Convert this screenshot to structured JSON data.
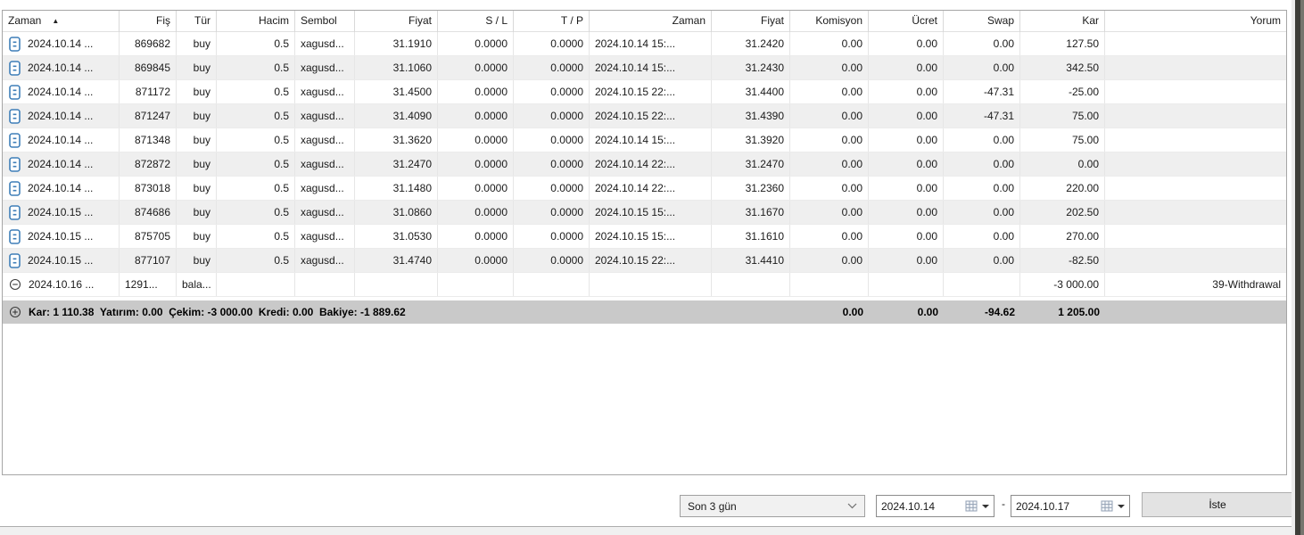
{
  "table": {
    "sort": {
      "column": "Zaman",
      "direction": "asc",
      "indicator": "▲"
    },
    "columns": [
      {
        "id": "time",
        "label": "Zaman"
      },
      {
        "id": "deal",
        "label": "Fiş"
      },
      {
        "id": "type",
        "label": "Tür"
      },
      {
        "id": "volume",
        "label": "Hacim"
      },
      {
        "id": "symbol",
        "label": "Sembol"
      },
      {
        "id": "price",
        "label": "Fiyat"
      },
      {
        "id": "sl",
        "label": "S / L"
      },
      {
        "id": "tp",
        "label": "T / P"
      },
      {
        "id": "close_time",
        "label": "Zaman"
      },
      {
        "id": "close_price",
        "label": "Fiyat"
      },
      {
        "id": "commission",
        "label": "Komisyon"
      },
      {
        "id": "fee",
        "label": "Ücret"
      },
      {
        "id": "swap",
        "label": "Swap"
      },
      {
        "id": "profit",
        "label": "Kar"
      },
      {
        "id": "comment",
        "label": "Yorum"
      }
    ],
    "rows": [
      {
        "icon": "receipt-icon",
        "time": "2024.10.14 ...",
        "deal": "869682",
        "type": "buy",
        "volume": "0.5",
        "symbol": "xagusd...",
        "price": "31.1910",
        "sl": "0.0000",
        "tp": "0.0000",
        "close_time": "2024.10.14 15:...",
        "close_price": "31.2420",
        "commission": "0.00",
        "fee": "0.00",
        "swap": "0.00",
        "profit": "127.50",
        "comment": ""
      },
      {
        "icon": "receipt-icon",
        "time": "2024.10.14 ...",
        "deal": "869845",
        "type": "buy",
        "volume": "0.5",
        "symbol": "xagusd...",
        "price": "31.1060",
        "sl": "0.0000",
        "tp": "0.0000",
        "close_time": "2024.10.14 15:...",
        "close_price": "31.2430",
        "commission": "0.00",
        "fee": "0.00",
        "swap": "0.00",
        "profit": "342.50",
        "comment": ""
      },
      {
        "icon": "receipt-icon",
        "time": "2024.10.14 ...",
        "deal": "871172",
        "type": "buy",
        "volume": "0.5",
        "symbol": "xagusd...",
        "price": "31.4500",
        "sl": "0.0000",
        "tp": "0.0000",
        "close_time": "2024.10.15 22:...",
        "close_price": "31.4400",
        "commission": "0.00",
        "fee": "0.00",
        "swap": "-47.31",
        "profit": "-25.00",
        "comment": ""
      },
      {
        "icon": "receipt-icon",
        "time": "2024.10.14 ...",
        "deal": "871247",
        "type": "buy",
        "volume": "0.5",
        "symbol": "xagusd...",
        "price": "31.4090",
        "sl": "0.0000",
        "tp": "0.0000",
        "close_time": "2024.10.15 22:...",
        "close_price": "31.4390",
        "commission": "0.00",
        "fee": "0.00",
        "swap": "-47.31",
        "profit": "75.00",
        "comment": ""
      },
      {
        "icon": "receipt-icon",
        "time": "2024.10.14 ...",
        "deal": "871348",
        "type": "buy",
        "volume": "0.5",
        "symbol": "xagusd...",
        "price": "31.3620",
        "sl": "0.0000",
        "tp": "0.0000",
        "close_time": "2024.10.14 15:...",
        "close_price": "31.3920",
        "commission": "0.00",
        "fee": "0.00",
        "swap": "0.00",
        "profit": "75.00",
        "comment": ""
      },
      {
        "icon": "receipt-icon",
        "time": "2024.10.14 ...",
        "deal": "872872",
        "type": "buy",
        "volume": "0.5",
        "symbol": "xagusd...",
        "price": "31.2470",
        "sl": "0.0000",
        "tp": "0.0000",
        "close_time": "2024.10.14 22:...",
        "close_price": "31.2470",
        "commission": "0.00",
        "fee": "0.00",
        "swap": "0.00",
        "profit": "0.00",
        "comment": ""
      },
      {
        "icon": "receipt-icon",
        "time": "2024.10.14 ...",
        "deal": "873018",
        "type": "buy",
        "volume": "0.5",
        "symbol": "xagusd...",
        "price": "31.1480",
        "sl": "0.0000",
        "tp": "0.0000",
        "close_time": "2024.10.14 22:...",
        "close_price": "31.2360",
        "commission": "0.00",
        "fee": "0.00",
        "swap": "0.00",
        "profit": "220.00",
        "comment": ""
      },
      {
        "icon": "receipt-icon",
        "time": "2024.10.15 ...",
        "deal": "874686",
        "type": "buy",
        "volume": "0.5",
        "symbol": "xagusd...",
        "price": "31.0860",
        "sl": "0.0000",
        "tp": "0.0000",
        "close_time": "2024.10.15 15:...",
        "close_price": "31.1670",
        "commission": "0.00",
        "fee": "0.00",
        "swap": "0.00",
        "profit": "202.50",
        "comment": ""
      },
      {
        "icon": "receipt-icon",
        "time": "2024.10.15 ...",
        "deal": "875705",
        "type": "buy",
        "volume": "0.5",
        "symbol": "xagusd...",
        "price": "31.0530",
        "sl": "0.0000",
        "tp": "0.0000",
        "close_time": "2024.10.15 15:...",
        "close_price": "31.1610",
        "commission": "0.00",
        "fee": "0.00",
        "swap": "0.00",
        "profit": "270.00",
        "comment": ""
      },
      {
        "icon": "receipt-icon",
        "time": "2024.10.15 ...",
        "deal": "877107",
        "type": "buy",
        "volume": "0.5",
        "symbol": "xagusd...",
        "price": "31.4740",
        "sl": "0.0000",
        "tp": "0.0000",
        "close_time": "2024.10.15 22:...",
        "close_price": "31.4410",
        "commission": "0.00",
        "fee": "0.00",
        "swap": "0.00",
        "profit": "-82.50",
        "comment": ""
      },
      {
        "icon": "circle-minus-icon",
        "time": "2024.10.16 ...",
        "deal": "1291...",
        "type": "bala...",
        "volume": "",
        "symbol": "",
        "price": "",
        "sl": "",
        "tp": "",
        "close_time": "",
        "close_price": "",
        "commission": "",
        "fee": "",
        "swap": "",
        "profit": "-3 000.00",
        "comment": "39-Withdrawal"
      }
    ],
    "summary_row": {
      "icon": "circle-plus-icon",
      "label": "Kar: 1 110.38  Yatırım: 0.00  Çekim: -3 000.00  Kredi: 0.00  Bakiye: -1 889.62",
      "commission": "0.00",
      "fee": "0.00",
      "swap": "-94.62",
      "profit": "1 205.00"
    }
  },
  "footer": {
    "period_value": "Son 3 gün",
    "date_from": "2024.10.14",
    "range_separator": "-",
    "date_to": "2024.10.17",
    "request_label": "İste"
  },
  "colors": {
    "accent_blue": "#3e7eb8",
    "summary_bg": "#c9c9c9",
    "alt_row_bg": "#efefef"
  }
}
